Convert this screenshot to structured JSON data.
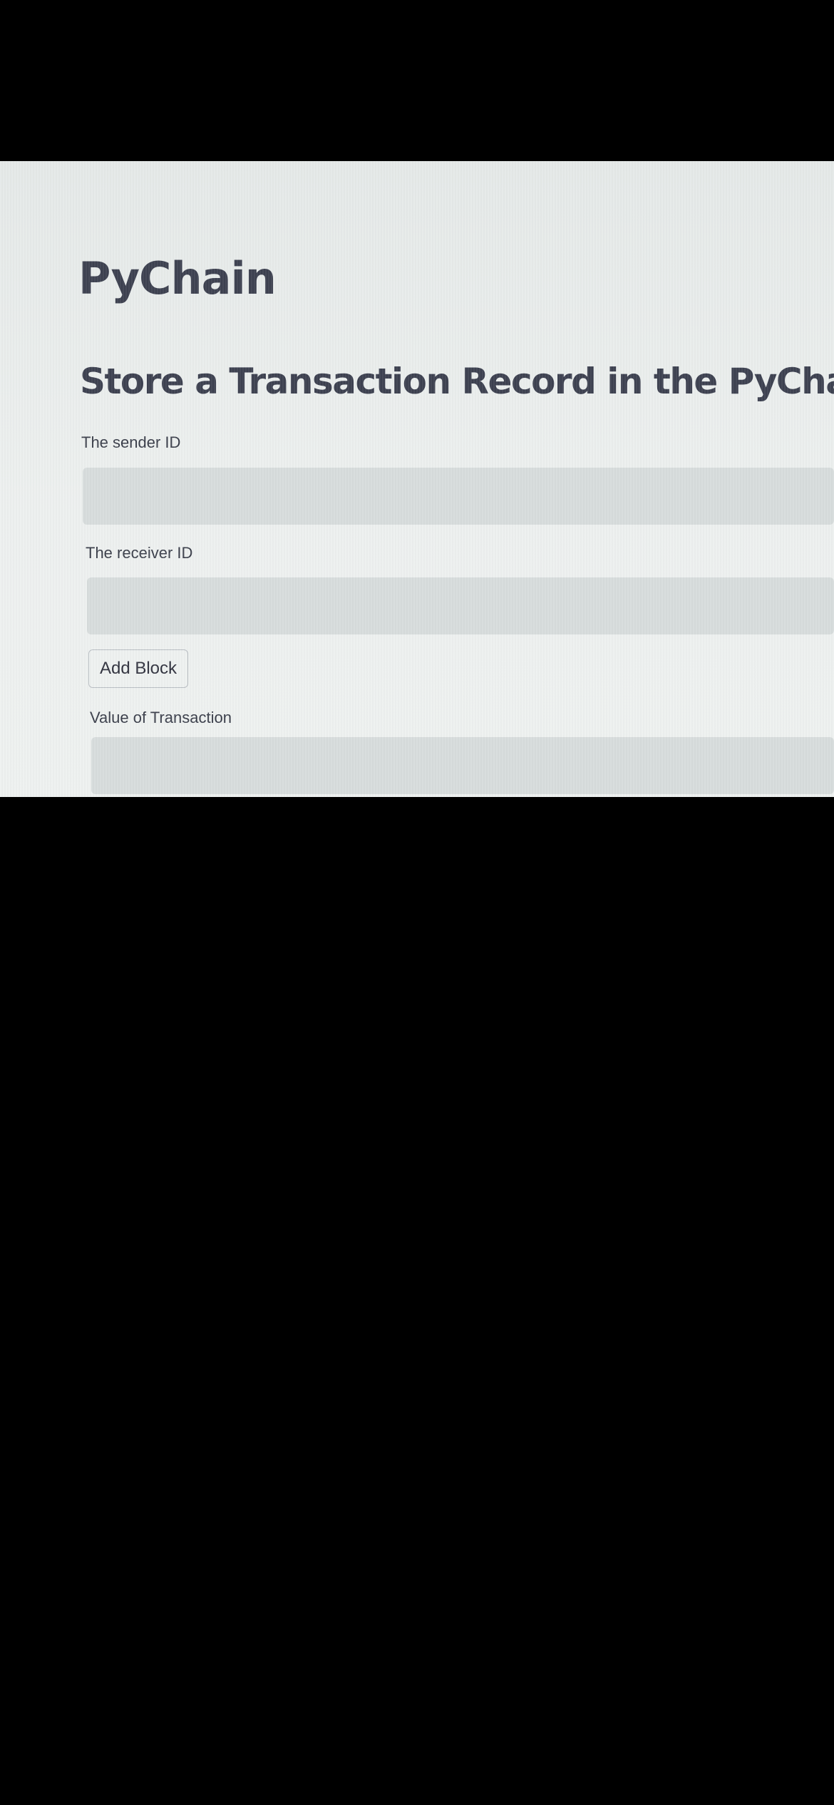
{
  "app": {
    "title": "PyChain"
  },
  "form": {
    "heading": "Store a Transaction Record in the PyChain",
    "sender": {
      "label": "The sender ID",
      "value": ""
    },
    "receiver": {
      "label": "The receiver ID",
      "value": ""
    },
    "add_block_label": "Add Block",
    "transaction_value": {
      "label": "Value of Transaction",
      "value": ""
    }
  },
  "colors": {
    "screen_background": "#edf0ef",
    "input_background": "#d7dcdc",
    "text": "#3d4150",
    "photo_background": "#000000"
  }
}
